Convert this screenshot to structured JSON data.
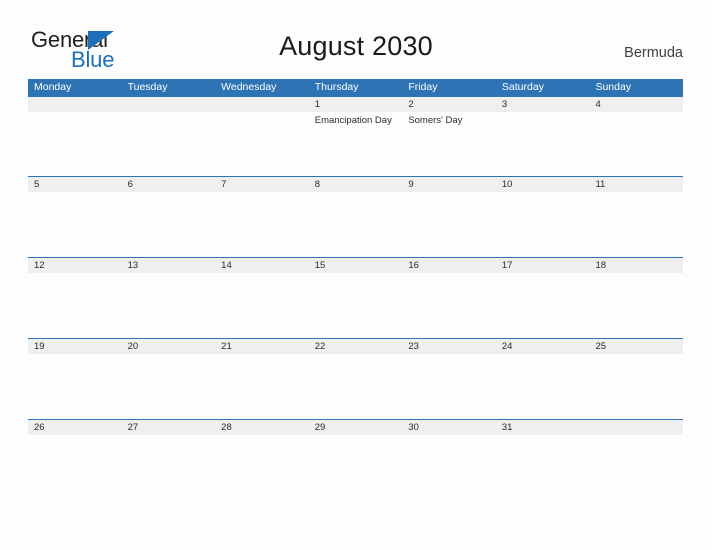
{
  "logo": {
    "word_one": "General",
    "word_two": "Blue",
    "triangle_icon": "triangle-right-icon",
    "brand_blue": "#1d70b7",
    "brand_dark": "#231f20"
  },
  "header": {
    "title": "August 2030",
    "country": "Bermuda"
  },
  "theme": {
    "header_blue": "#2e74b5",
    "band_gray": "#efefef",
    "page_background": "#fdfdfd",
    "text_dark": "#2b2b2b"
  },
  "calendar": {
    "day_headers": [
      "Monday",
      "Tuesday",
      "Wednesday",
      "Thursday",
      "Friday",
      "Saturday",
      "Sunday"
    ],
    "weeks": [
      {
        "days": [
          {
            "num": "",
            "events": []
          },
          {
            "num": "",
            "events": []
          },
          {
            "num": "",
            "events": []
          },
          {
            "num": "1",
            "events": [
              "Emancipation Day"
            ]
          },
          {
            "num": "2",
            "events": [
              "Somers' Day"
            ]
          },
          {
            "num": "3",
            "events": []
          },
          {
            "num": "4",
            "events": []
          }
        ]
      },
      {
        "days": [
          {
            "num": "5",
            "events": []
          },
          {
            "num": "6",
            "events": []
          },
          {
            "num": "7",
            "events": []
          },
          {
            "num": "8",
            "events": []
          },
          {
            "num": "9",
            "events": []
          },
          {
            "num": "10",
            "events": []
          },
          {
            "num": "11",
            "events": []
          }
        ]
      },
      {
        "days": [
          {
            "num": "12",
            "events": []
          },
          {
            "num": "13",
            "events": []
          },
          {
            "num": "14",
            "events": []
          },
          {
            "num": "15",
            "events": []
          },
          {
            "num": "16",
            "events": []
          },
          {
            "num": "17",
            "events": []
          },
          {
            "num": "18",
            "events": []
          }
        ]
      },
      {
        "days": [
          {
            "num": "19",
            "events": []
          },
          {
            "num": "20",
            "events": []
          },
          {
            "num": "21",
            "events": []
          },
          {
            "num": "22",
            "events": []
          },
          {
            "num": "23",
            "events": []
          },
          {
            "num": "24",
            "events": []
          },
          {
            "num": "25",
            "events": []
          }
        ]
      },
      {
        "days": [
          {
            "num": "26",
            "events": []
          },
          {
            "num": "27",
            "events": []
          },
          {
            "num": "28",
            "events": []
          },
          {
            "num": "29",
            "events": []
          },
          {
            "num": "30",
            "events": []
          },
          {
            "num": "31",
            "events": []
          },
          {
            "num": "",
            "events": []
          }
        ]
      }
    ]
  }
}
